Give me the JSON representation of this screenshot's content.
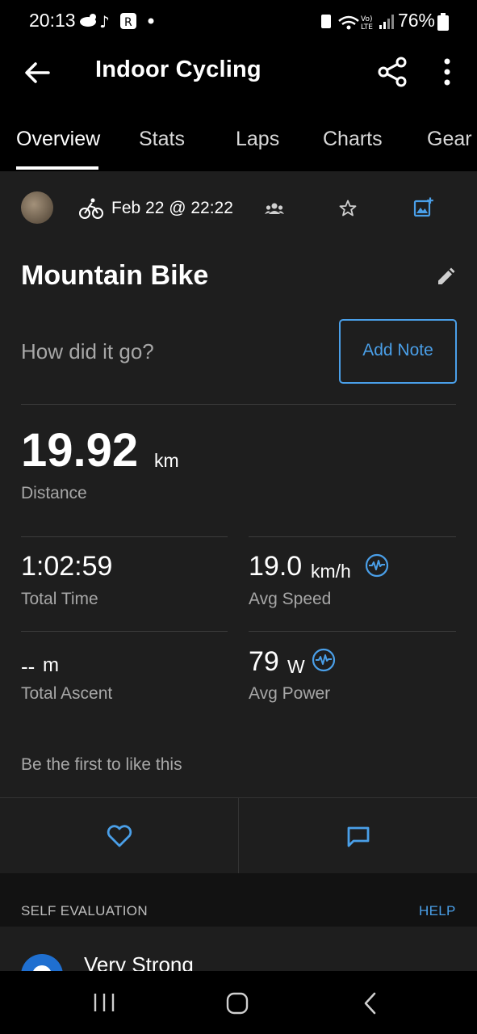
{
  "status_bar": {
    "time": "20:13",
    "battery": "76%"
  },
  "app_bar": {
    "title": "Indoor Cycling"
  },
  "tabs": [
    {
      "label": "Overview"
    },
    {
      "label": "Stats"
    },
    {
      "label": "Laps"
    },
    {
      "label": "Charts"
    },
    {
      "label": "Gear"
    }
  ],
  "activity": {
    "date": "Feb 22 @ 22:22",
    "name": "Mountain Bike",
    "note_prompt": "How did it go?",
    "add_note_label": "Add Note"
  },
  "distance": {
    "value": "19.92",
    "unit": "km",
    "label": "Distance"
  },
  "stats": {
    "total_time": {
      "value": "1:02:59",
      "label": "Total Time"
    },
    "avg_speed": {
      "value": "19.0",
      "unit": "km/h",
      "label": "Avg Speed"
    },
    "total_ascent": {
      "value": "--",
      "unit": "m",
      "label": "Total Ascent"
    },
    "avg_power": {
      "value": "79",
      "unit": "W",
      "label": "Avg Power"
    }
  },
  "social": {
    "likes_text": "Be the first to like this"
  },
  "self_evaluation": {
    "header": "SELF EVALUATION",
    "help": "HELP",
    "value": "Very Strong"
  },
  "colors": {
    "accent": "#4a9fe8",
    "background": "#1e1e1e",
    "bar": "#000000"
  }
}
